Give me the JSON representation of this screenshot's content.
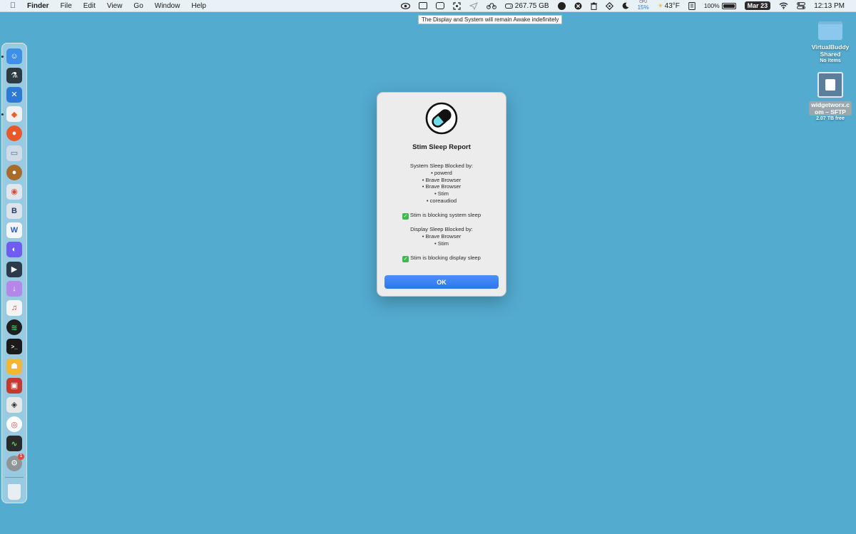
{
  "menubar": {
    "app_name": "Finder",
    "menus": [
      "File",
      "Edit",
      "View",
      "Go",
      "Window",
      "Help"
    ],
    "status": {
      "disk": "267.75 GB",
      "cpu_label": "CPU",
      "cpu_value": "15%",
      "weather": "43°F",
      "battery": "100%",
      "date": "Mar 23",
      "time": "12:13 PM"
    }
  },
  "tooltip": "The Display and System will remain Awake indefinitely",
  "desktop": {
    "items": [
      {
        "name": "VirtualBuddy Shared",
        "sub": "No items"
      },
      {
        "name": "widgetworx.c om – SFTP",
        "sub": "2.07 TB free"
      }
    ]
  },
  "dialog": {
    "title": "Stim Sleep Report",
    "system_heading": "System Sleep Blocked by:",
    "system_list": [
      "• powerd",
      "• Brave Browser",
      "• Brave Browser",
      "• Stim",
      "• coreaudiod"
    ],
    "system_status": "Stim is blocking system sleep",
    "display_heading": "Display Sleep Blocked by:",
    "display_list": [
      "• Brave Browser",
      "• Stim"
    ],
    "display_status": "Stim is blocking display sleep",
    "ok_label": "OK"
  },
  "dock": {
    "apps": [
      {
        "name": "finder-icon",
        "color": "#3d8fe8"
      },
      {
        "name": "flask-icon",
        "color": "#2d3a3f"
      },
      {
        "name": "xcode-tools-icon",
        "color": "#2d7ad6"
      },
      {
        "name": "brave-icon",
        "color": "#f1f1f1"
      },
      {
        "name": "firefox-icon",
        "color": "#e8582b"
      },
      {
        "name": "preview-icon",
        "color": "#cfdbe6"
      },
      {
        "name": "acorn-icon",
        "color": "#a86b2a"
      },
      {
        "name": "chrome-app-icon",
        "color": "#e0e6ec"
      },
      {
        "name": "bbedit-icon",
        "color": "#dde3ea"
      },
      {
        "name": "word-icon",
        "color": "#f4f6f8"
      },
      {
        "name": "arc-icon",
        "color": "#6e5df0"
      },
      {
        "name": "infuse-icon",
        "color": "#2b3b4b"
      },
      {
        "name": "downie-icon",
        "color": "#b587e8"
      },
      {
        "name": "headphones-icon",
        "color": "#f4f4f4"
      },
      {
        "name": "spotify-icon",
        "color": "#1f1f1f"
      },
      {
        "name": "terminal-icon",
        "color": "#1b1b1b"
      },
      {
        "name": "bartender-icon",
        "color": "#f2b632"
      },
      {
        "name": "photo-app-icon",
        "color": "#c63a2e"
      },
      {
        "name": "layers-icon",
        "color": "#e8e8e8"
      },
      {
        "name": "lifesaver-icon",
        "color": "#ffffff"
      },
      {
        "name": "activity-monitor-icon",
        "color": "#2a2a2a"
      },
      {
        "name": "system-settings-icon",
        "color": "#8f9497"
      }
    ],
    "settings_badge": "1",
    "trash": {
      "name": "trash-icon",
      "color": "#e9eef1"
    }
  }
}
